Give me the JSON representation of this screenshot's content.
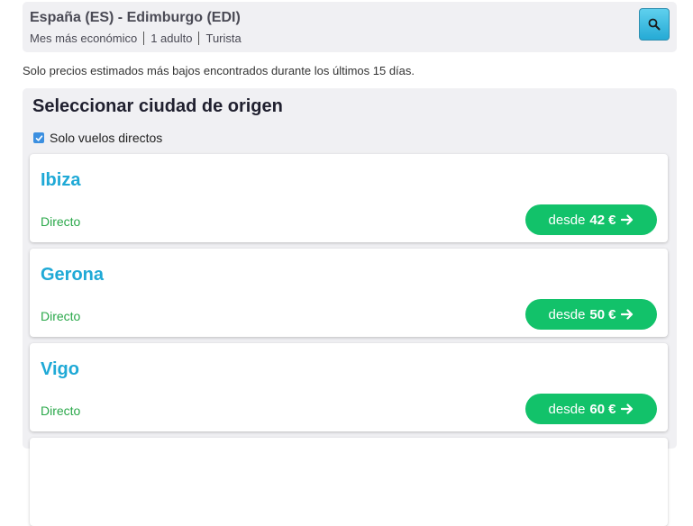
{
  "search": {
    "route": "España (ES) - Edimburgo (EDI)",
    "month": "Mes más económico",
    "passengers": "1 adulto",
    "cabin": "Turista",
    "button_icon": "search-icon"
  },
  "info_text": "Solo precios estimados más bajos encontrados durante los últimos 15 días.",
  "origin_panel": {
    "title": "Seleccionar ciudad de origen",
    "direct_only_label": "Solo vuelos directos",
    "direct_only_checked": true
  },
  "results": [
    {
      "city": "Ibiza",
      "stops": "Directo",
      "price_prefix": "desde",
      "price": "42",
      "currency": "€"
    },
    {
      "city": "Gerona",
      "stops": "Directo",
      "price_prefix": "desde",
      "price": "50",
      "currency": "€"
    },
    {
      "city": "Vigo",
      "stops": "Directo",
      "price_prefix": "desde",
      "price": "60",
      "currency": "€"
    }
  ],
  "colors": {
    "accent_blue": "#1fa9d6",
    "price_green": "#12c26a",
    "direct_green": "#2aa84a",
    "panel_bg": "#f0f0f3"
  }
}
